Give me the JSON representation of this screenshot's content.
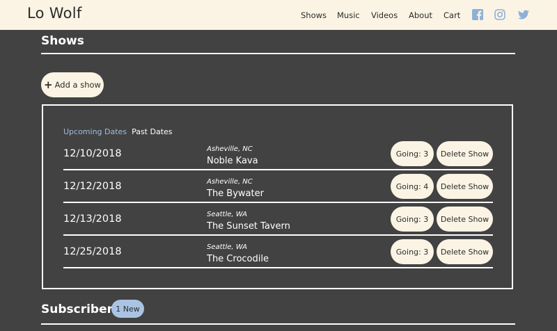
{
  "header": {
    "brand": "Lo Wolf",
    "nav": [
      "Shows",
      "Music",
      "Videos",
      "About",
      "Cart"
    ],
    "social_icons": [
      "facebook-icon",
      "instagram-icon",
      "twitter-icon"
    ],
    "social_color": "#8fb0d6",
    "background": "#fbf4e4"
  },
  "shows": {
    "title": "Shows",
    "add_label": "Add a show",
    "tabs": {
      "upcoming": "Upcoming Dates",
      "past": "Past Dates"
    },
    "rows": [
      {
        "date": "12/10/2018",
        "location": "Asheville, NC",
        "venue": "Noble Kava",
        "going": "Going: 3",
        "delete": "Delete Show"
      },
      {
        "date": "12/12/2018",
        "location": "Asheville, NC",
        "venue": "The Bywater",
        "going": "Going: 4",
        "delete": "Delete Show"
      },
      {
        "date": "12/13/2018",
        "location": "Seattle, WA",
        "venue": "The Sunset Tavern",
        "going": "Going: 3",
        "delete": "Delete Show"
      },
      {
        "date": "12/25/2018",
        "location": "Seattle, WA",
        "venue": "The Crocodile",
        "going": "Going: 3",
        "delete": "Delete Show"
      }
    ]
  },
  "subscribers": {
    "title": "Subscribers",
    "badge": "1 New"
  },
  "colors": {
    "page_background": "#424242",
    "accent": "#9fbde0",
    "pill_background": "#fbf4e4"
  }
}
